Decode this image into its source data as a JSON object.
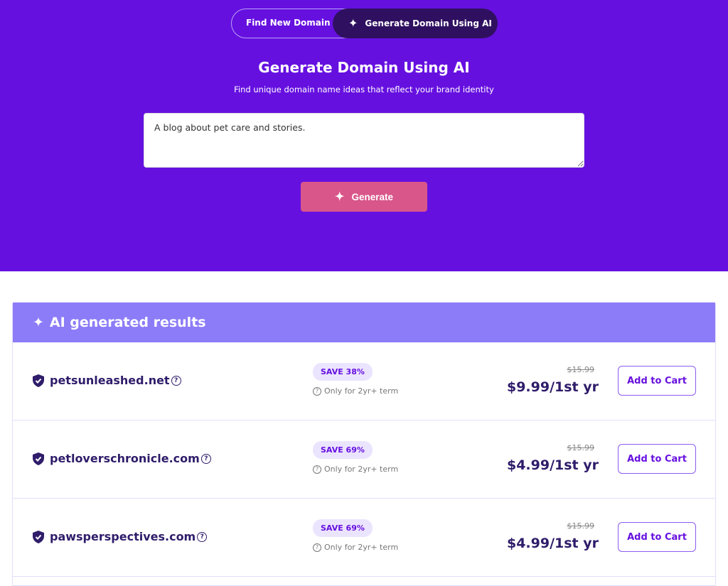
{
  "toggle": {
    "find_label": "Find New Domain",
    "ai_label": "Generate Domain Using AI"
  },
  "hero": {
    "title": "Generate Domain Using AI",
    "subtitle": "Find unique domain name ideas that reflect your brand identity",
    "input_value": "A blog about pet care and stories.",
    "generate_label": "Generate"
  },
  "results": {
    "title": "AI generated results",
    "items": [
      {
        "domain": "petsunleashed.net",
        "badge": "SAVE 38%",
        "note": "Only for 2yr+ term",
        "old_price": "$15.99",
        "price": "$9.99/1st yr",
        "cart": "Add to Cart"
      },
      {
        "domain": "petloverschronicle.com",
        "badge": "SAVE 69%",
        "note": "Only for 2yr+ term",
        "old_price": "$15.99",
        "price": "$4.99/1st yr",
        "cart": "Add to Cart"
      },
      {
        "domain": "pawsperspectives.com",
        "badge": "SAVE 69%",
        "note": "Only for 2yr+ term",
        "old_price": "$15.99",
        "price": "$4.99/1st yr",
        "cart": "Add to Cart"
      }
    ]
  },
  "colors": {
    "hero": "#6610e0",
    "accent": "#d9568a",
    "results_header": "#8c7cf8"
  }
}
